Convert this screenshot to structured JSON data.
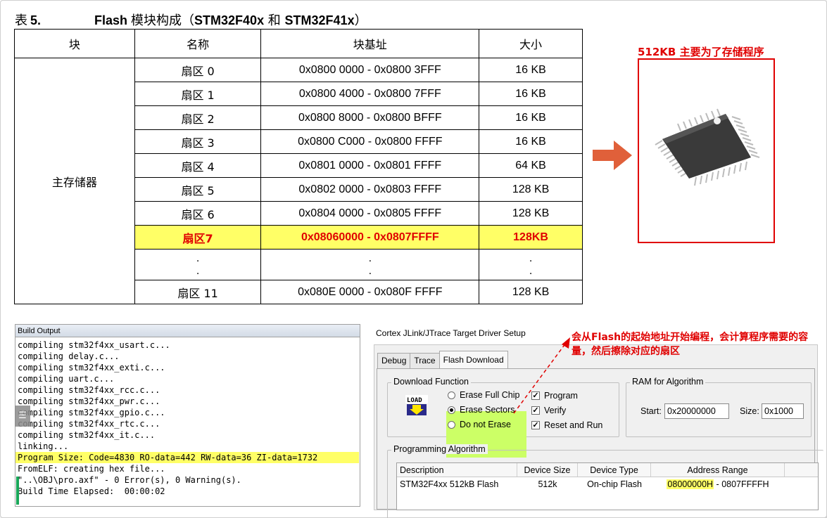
{
  "flash_table": {
    "caption_prefix": "表",
    "caption_number": "5.",
    "caption_title_a": "Flash",
    "caption_title_b": "模块构成（",
    "caption_title_c": "STM32F40x",
    "caption_title_d": " 和 ",
    "caption_title_e": "STM32F41x",
    "caption_title_f": "）",
    "headers": [
      "块",
      "名称",
      "块基址",
      "大小"
    ],
    "block_name": "主存储器",
    "rows": [
      {
        "name": "扇区 0",
        "range": "0x0800 0000 - 0x0800 3FFF",
        "size": "16 KB"
      },
      {
        "name": "扇区 1",
        "range": "0x0800 4000 - 0x0800 7FFF",
        "size": "16 KB"
      },
      {
        "name": "扇区 2",
        "range": "0x0800 8000 - 0x0800 BFFF",
        "size": "16 KB"
      },
      {
        "name": "扇区 3",
        "range": "0x0800 C000 - 0x0800 FFFF",
        "size": "16 KB"
      },
      {
        "name": "扇区 4",
        "range": "0x0801 0000 - 0x0801 FFFF",
        "size": "64 KB"
      },
      {
        "name": "扇区 5",
        "range": "0x0802 0000 - 0x0803 FFFF",
        "size": "128 KB"
      },
      {
        "name": "扇区 6",
        "range": "0x0804 0000 - 0x0805 FFFF",
        "size": "128 KB"
      },
      {
        "name": "扇区7",
        "range": "0x08060000 - 0x0807FFFF",
        "size": "128KB"
      }
    ],
    "dots": ".",
    "last_row": {
      "name": "扇区 11",
      "range": "0x080E 0000 - 0x080F FFFF",
      "size": "128 KB"
    }
  },
  "chip": {
    "label": "512KB  主要为了存储程序",
    "arrow_icon": "right-arrow-icon",
    "image_icon": "lqfp-chip-icon"
  },
  "build_output": {
    "title": "Build Output",
    "lines": [
      "compiling stm32f4xx_usart.c...",
      "compiling delay.c...",
      "compiling stm32f4xx_exti.c...",
      "compiling uart.c...",
      "compiling stm32f4xx_rcc.c...",
      "compiling stm32f4xx_pwr.c...",
      "compiling stm32f4xx_gpio.c...",
      "compiling stm32f4xx_rtc.c...",
      "compiling stm32f4xx_it.c...",
      "linking...",
      "Program Size: Code=4830 RO-data=442 RW-data=36 ZI-data=1732",
      "FromELF: creating hex file...",
      "\"..\\OBJ\\pro.axf\" - 0 Error(s), 0 Warning(s).",
      "Build Time Elapsed:  00:00:02"
    ]
  },
  "driver": {
    "title": "Cortex JLink/JTrace Target Driver Setup",
    "tabs": [
      "Debug",
      "Trace",
      "Flash Download"
    ],
    "download_group": "Download Function",
    "load_icon_text": "LOAD",
    "erase_full": "Erase Full Chip",
    "erase_sectors": "Erase Sectors",
    "no_erase": "Do not Erase",
    "program": "Program",
    "verify": "Verify",
    "reset_run": "Reset and Run",
    "ram_group": "RAM for Algorithm",
    "start_label": "Start:",
    "start_value": "0x20000000",
    "size_label": "Size:",
    "size_value": "0x1000",
    "algo_group": "Programming Algorithm",
    "algo_headers": [
      "Description",
      "Device Size",
      "Device Type",
      "Address Range"
    ],
    "algo_row": {
      "desc": "STM32F4xx 512kB Flash",
      "size": "512k",
      "type": "On-chip Flash",
      "addr_start": "08000000H",
      "addr_sep": " - ",
      "addr_end": "0807FFFFH"
    }
  },
  "annotation": {
    "text": "会从Flash的起始地址开始编程，会计算程序需要的容量，然后擦除对应的扇区"
  },
  "colors": {
    "highlight_yellow": "#ffff66",
    "annotation_red": "#e00000",
    "green_highlight": "#ccff66",
    "arrow_orange": "#e0603a"
  }
}
